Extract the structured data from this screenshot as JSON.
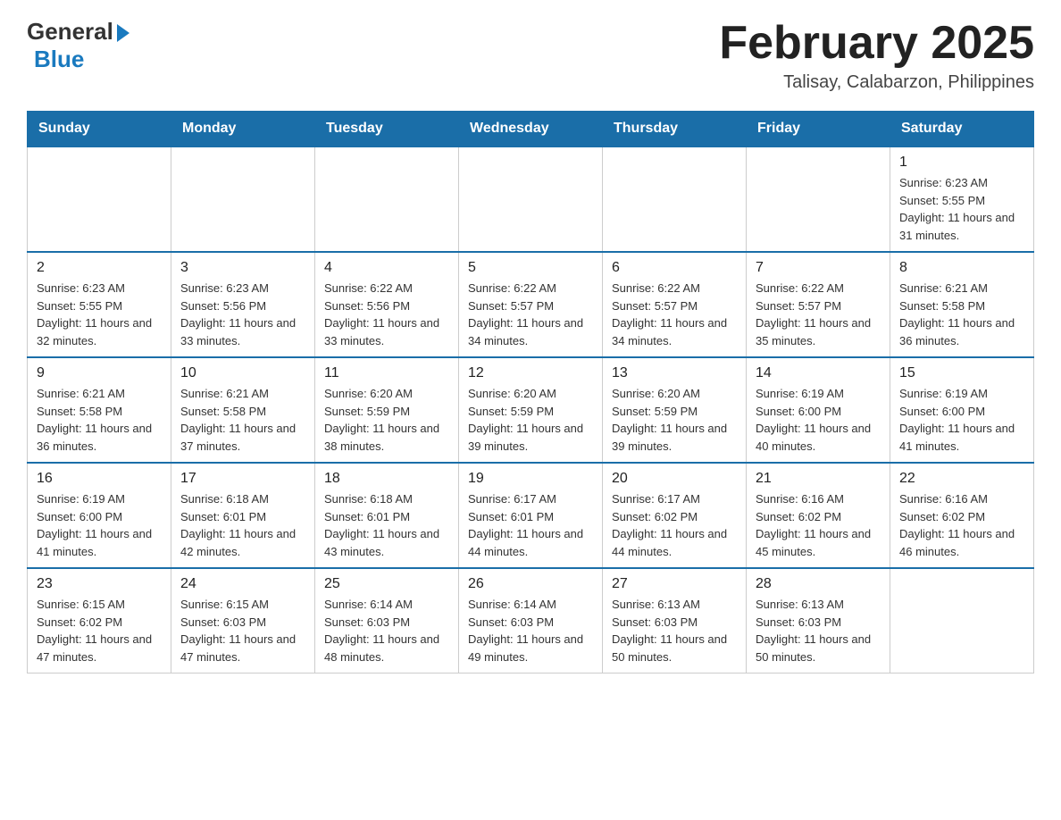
{
  "header": {
    "logo_general": "General",
    "logo_blue": "Blue",
    "month_title": "February 2025",
    "location": "Talisay, Calabarzon, Philippines"
  },
  "days_of_week": [
    "Sunday",
    "Monday",
    "Tuesday",
    "Wednesday",
    "Thursday",
    "Friday",
    "Saturday"
  ],
  "weeks": [
    [
      {
        "day": "",
        "info": ""
      },
      {
        "day": "",
        "info": ""
      },
      {
        "day": "",
        "info": ""
      },
      {
        "day": "",
        "info": ""
      },
      {
        "day": "",
        "info": ""
      },
      {
        "day": "",
        "info": ""
      },
      {
        "day": "1",
        "info": "Sunrise: 6:23 AM\nSunset: 5:55 PM\nDaylight: 11 hours and 31 minutes."
      }
    ],
    [
      {
        "day": "2",
        "info": "Sunrise: 6:23 AM\nSunset: 5:55 PM\nDaylight: 11 hours and 32 minutes."
      },
      {
        "day": "3",
        "info": "Sunrise: 6:23 AM\nSunset: 5:56 PM\nDaylight: 11 hours and 33 minutes."
      },
      {
        "day": "4",
        "info": "Sunrise: 6:22 AM\nSunset: 5:56 PM\nDaylight: 11 hours and 33 minutes."
      },
      {
        "day": "5",
        "info": "Sunrise: 6:22 AM\nSunset: 5:57 PM\nDaylight: 11 hours and 34 minutes."
      },
      {
        "day": "6",
        "info": "Sunrise: 6:22 AM\nSunset: 5:57 PM\nDaylight: 11 hours and 34 minutes."
      },
      {
        "day": "7",
        "info": "Sunrise: 6:22 AM\nSunset: 5:57 PM\nDaylight: 11 hours and 35 minutes."
      },
      {
        "day": "8",
        "info": "Sunrise: 6:21 AM\nSunset: 5:58 PM\nDaylight: 11 hours and 36 minutes."
      }
    ],
    [
      {
        "day": "9",
        "info": "Sunrise: 6:21 AM\nSunset: 5:58 PM\nDaylight: 11 hours and 36 minutes."
      },
      {
        "day": "10",
        "info": "Sunrise: 6:21 AM\nSunset: 5:58 PM\nDaylight: 11 hours and 37 minutes."
      },
      {
        "day": "11",
        "info": "Sunrise: 6:20 AM\nSunset: 5:59 PM\nDaylight: 11 hours and 38 minutes."
      },
      {
        "day": "12",
        "info": "Sunrise: 6:20 AM\nSunset: 5:59 PM\nDaylight: 11 hours and 39 minutes."
      },
      {
        "day": "13",
        "info": "Sunrise: 6:20 AM\nSunset: 5:59 PM\nDaylight: 11 hours and 39 minutes."
      },
      {
        "day": "14",
        "info": "Sunrise: 6:19 AM\nSunset: 6:00 PM\nDaylight: 11 hours and 40 minutes."
      },
      {
        "day": "15",
        "info": "Sunrise: 6:19 AM\nSunset: 6:00 PM\nDaylight: 11 hours and 41 minutes."
      }
    ],
    [
      {
        "day": "16",
        "info": "Sunrise: 6:19 AM\nSunset: 6:00 PM\nDaylight: 11 hours and 41 minutes."
      },
      {
        "day": "17",
        "info": "Sunrise: 6:18 AM\nSunset: 6:01 PM\nDaylight: 11 hours and 42 minutes."
      },
      {
        "day": "18",
        "info": "Sunrise: 6:18 AM\nSunset: 6:01 PM\nDaylight: 11 hours and 43 minutes."
      },
      {
        "day": "19",
        "info": "Sunrise: 6:17 AM\nSunset: 6:01 PM\nDaylight: 11 hours and 44 minutes."
      },
      {
        "day": "20",
        "info": "Sunrise: 6:17 AM\nSunset: 6:02 PM\nDaylight: 11 hours and 44 minutes."
      },
      {
        "day": "21",
        "info": "Sunrise: 6:16 AM\nSunset: 6:02 PM\nDaylight: 11 hours and 45 minutes."
      },
      {
        "day": "22",
        "info": "Sunrise: 6:16 AM\nSunset: 6:02 PM\nDaylight: 11 hours and 46 minutes."
      }
    ],
    [
      {
        "day": "23",
        "info": "Sunrise: 6:15 AM\nSunset: 6:02 PM\nDaylight: 11 hours and 47 minutes."
      },
      {
        "day": "24",
        "info": "Sunrise: 6:15 AM\nSunset: 6:03 PM\nDaylight: 11 hours and 47 minutes."
      },
      {
        "day": "25",
        "info": "Sunrise: 6:14 AM\nSunset: 6:03 PM\nDaylight: 11 hours and 48 minutes."
      },
      {
        "day": "26",
        "info": "Sunrise: 6:14 AM\nSunset: 6:03 PM\nDaylight: 11 hours and 49 minutes."
      },
      {
        "day": "27",
        "info": "Sunrise: 6:13 AM\nSunset: 6:03 PM\nDaylight: 11 hours and 50 minutes."
      },
      {
        "day": "28",
        "info": "Sunrise: 6:13 AM\nSunset: 6:03 PM\nDaylight: 11 hours and 50 minutes."
      },
      {
        "day": "",
        "info": ""
      }
    ]
  ]
}
